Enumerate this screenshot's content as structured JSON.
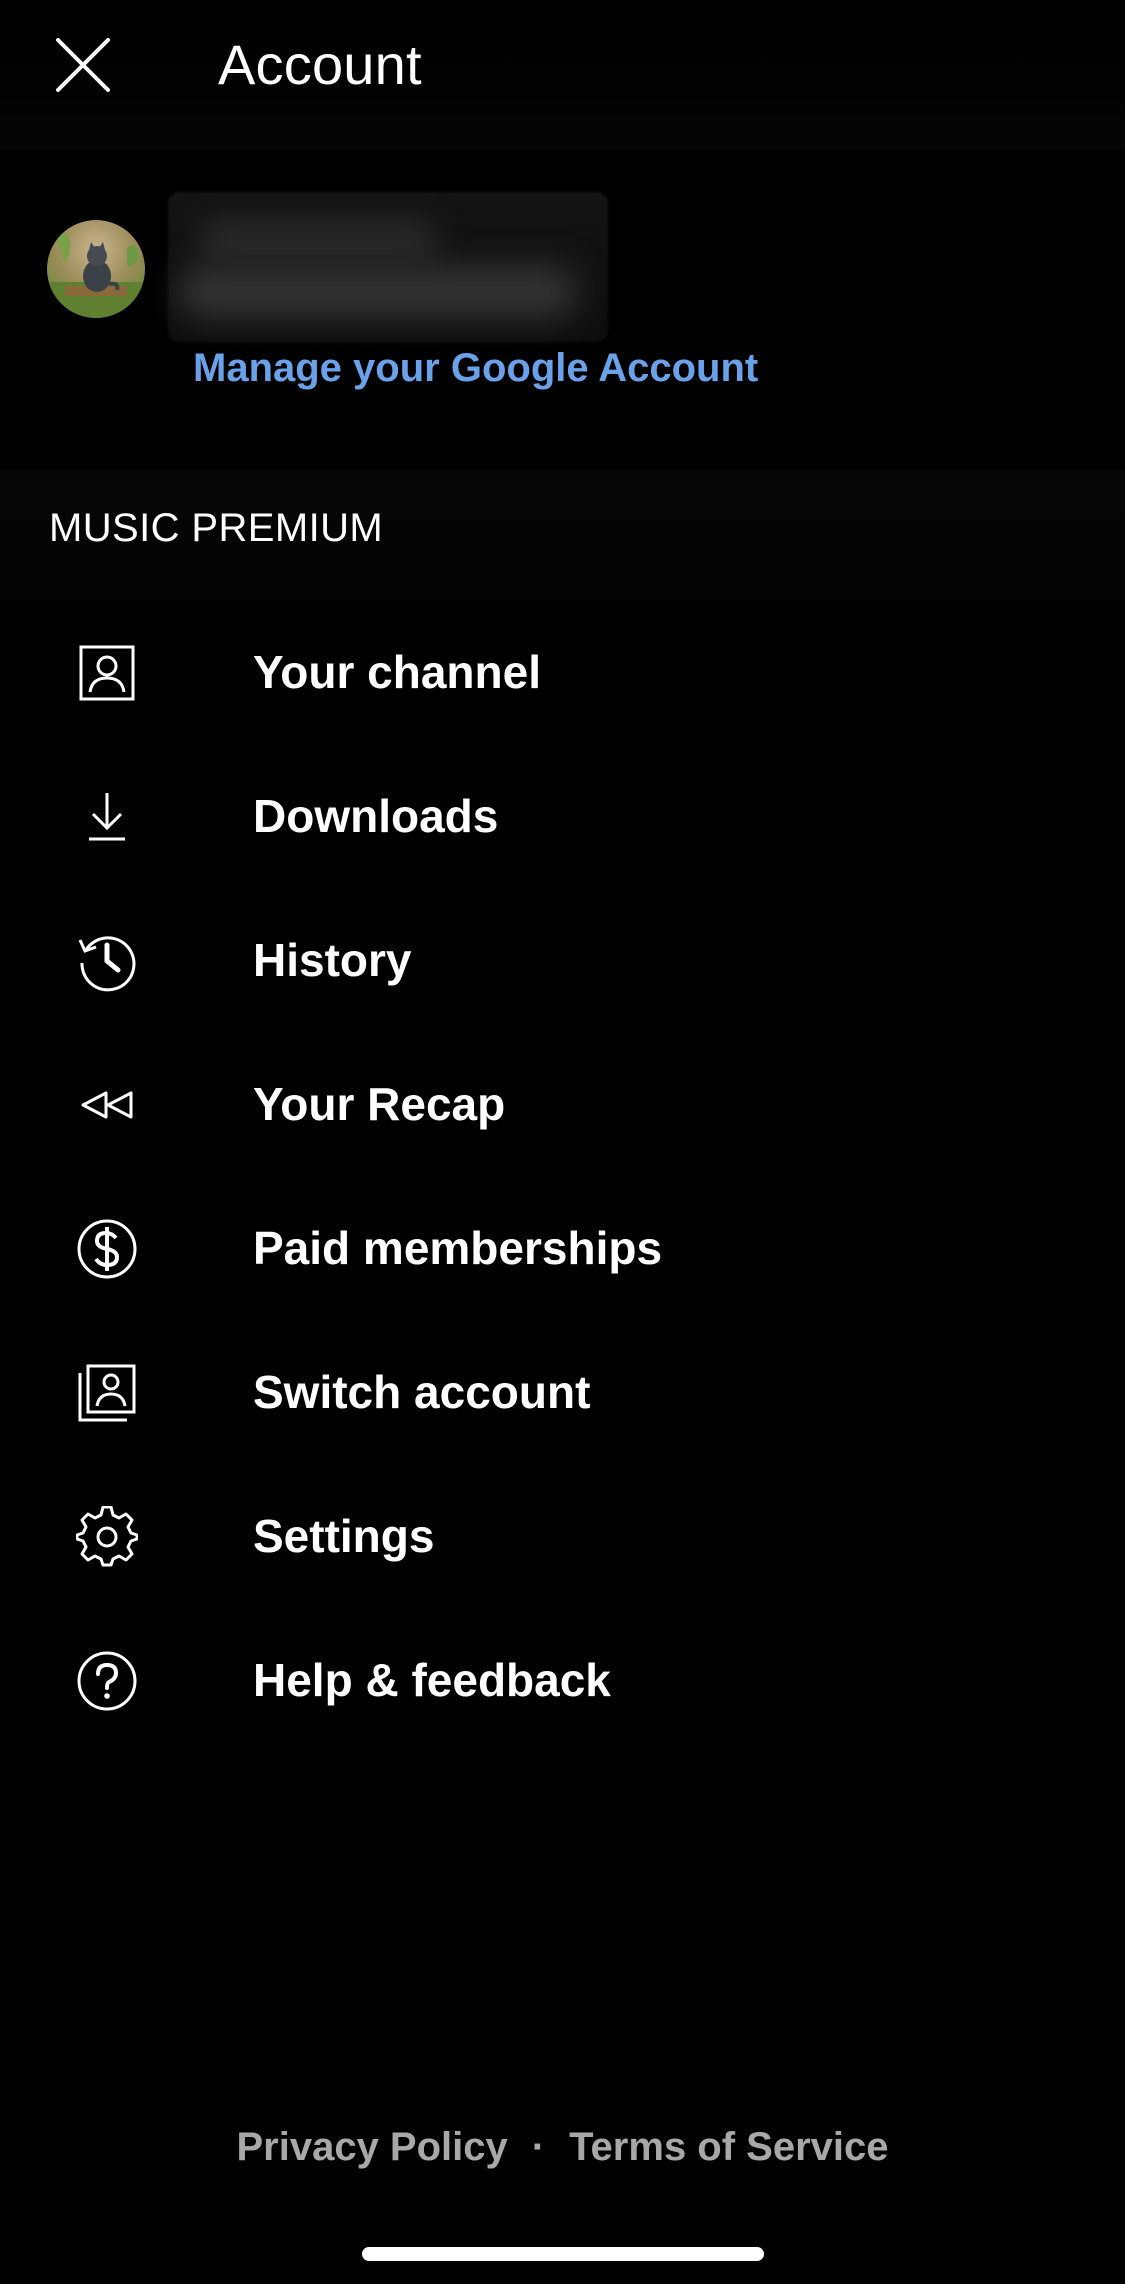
{
  "header": {
    "title": "Account",
    "close_icon": "close-icon"
  },
  "profile": {
    "avatar_icon": "avatar",
    "manage_link": "Manage your Google Account"
  },
  "section": {
    "title": "MUSIC PREMIUM"
  },
  "menu": {
    "items": [
      {
        "label": "Your channel",
        "icon": "person-icon"
      },
      {
        "label": "Downloads",
        "icon": "download-icon"
      },
      {
        "label": "History",
        "icon": "history-icon"
      },
      {
        "label": "Your Recap",
        "icon": "rewind-icon"
      },
      {
        "label": "Paid memberships",
        "icon": "dollar-icon"
      },
      {
        "label": "Switch account",
        "icon": "switch-account-icon"
      },
      {
        "label": "Settings",
        "icon": "gear-icon"
      },
      {
        "label": "Help & feedback",
        "icon": "help-icon"
      }
    ]
  },
  "footer": {
    "privacy": "Privacy Policy",
    "separator": "·",
    "terms": "Terms of Service"
  },
  "colors": {
    "background": "#000000",
    "link": "#6aa2ea",
    "footer_text": "#a8a8a8"
  }
}
